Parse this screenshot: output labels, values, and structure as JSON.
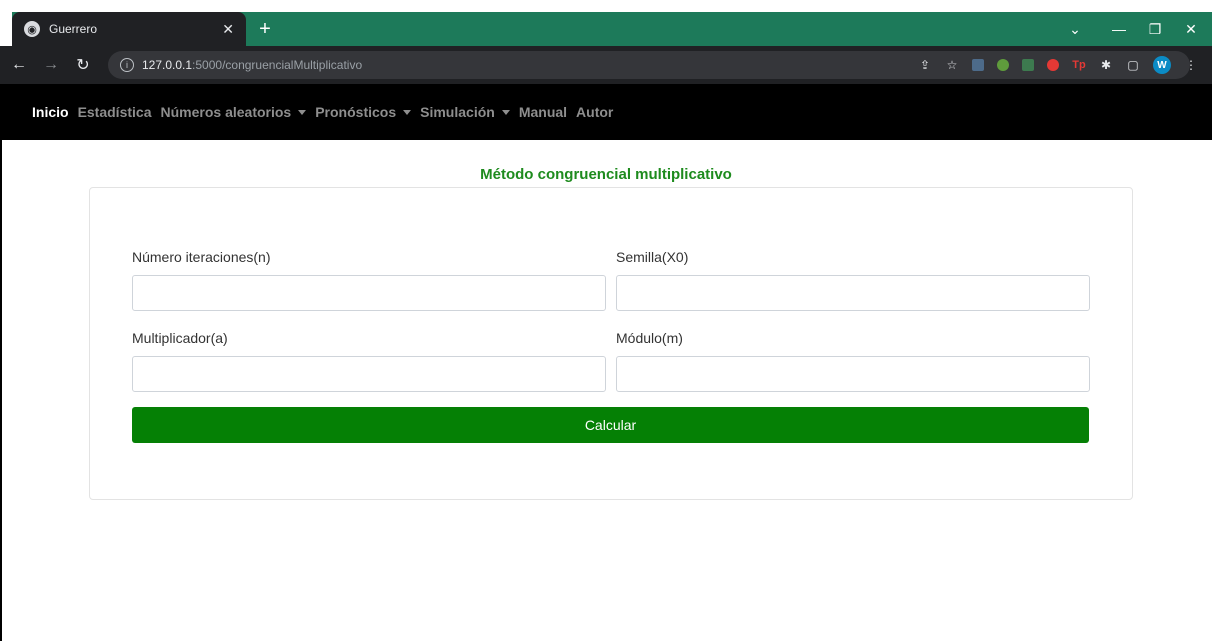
{
  "browser": {
    "tab_title": "Guerrero",
    "url_host": "127.0.0.1",
    "url_path": ":5000/congruencialMultiplicativo",
    "avatar_letter": "W",
    "ext_label": "Tp"
  },
  "navbar": {
    "items": [
      {
        "label": "Inicio",
        "active": true,
        "dropdown": false
      },
      {
        "label": "Estadística",
        "active": false,
        "dropdown": false
      },
      {
        "label": "Números aleatorios",
        "active": false,
        "dropdown": true
      },
      {
        "label": "Pronósticos",
        "active": false,
        "dropdown": true
      },
      {
        "label": "Simulación",
        "active": false,
        "dropdown": true
      },
      {
        "label": "Manual",
        "active": false,
        "dropdown": false
      },
      {
        "label": "Autor",
        "active": false,
        "dropdown": false
      }
    ]
  },
  "main": {
    "title": "Método congruencial multiplicativo",
    "fields": {
      "iterations": {
        "label": "Número iteraciones(n)",
        "value": ""
      },
      "seed": {
        "label": "Semilla(X0)",
        "value": ""
      },
      "multiplier": {
        "label": "Multiplicador(a)",
        "value": ""
      },
      "modulus": {
        "label": "Módulo(m)",
        "value": ""
      }
    },
    "submit_label": "Calcular"
  },
  "colors": {
    "accent": "#058005",
    "title": "#1e8b1e",
    "tabstrip": "#1d7a5a",
    "navbar": "#000000"
  }
}
